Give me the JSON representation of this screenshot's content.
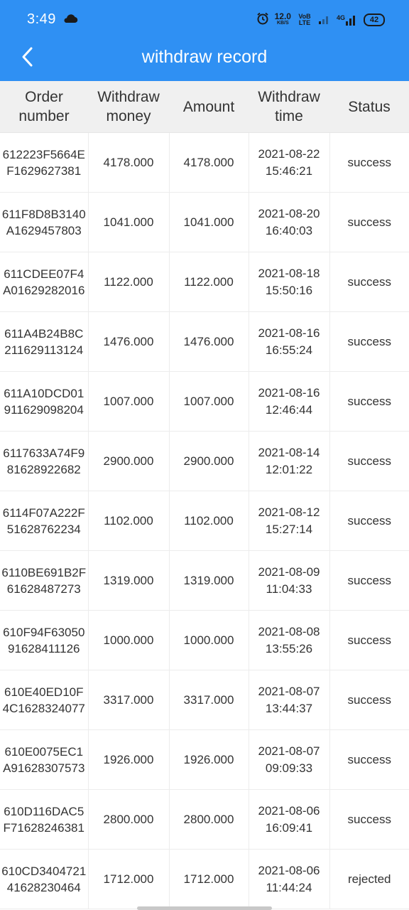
{
  "status_bar": {
    "time": "3:49",
    "net_speed": "12.0",
    "net_unit": "KB/S",
    "volte": "VoB LTE",
    "network": "4G",
    "battery": "42"
  },
  "header": {
    "title": "withdraw record"
  },
  "colors": {
    "header_bg": "#2f90f3",
    "table_header_bg": "#f0f0f0"
  },
  "columns": {
    "order": "Order number",
    "withdraw_money": "Withdraw money",
    "amount": "Amount",
    "withdraw_time": "Withdraw time",
    "status": "Status"
  },
  "records": [
    {
      "order": "612223F5664EF1629627381",
      "withdraw_money": "4178.000",
      "amount": "4178.000",
      "date": "2021-08-22",
      "time": "15:46:21",
      "status": "success"
    },
    {
      "order": "611F8D8B3140A1629457803",
      "withdraw_money": "1041.000",
      "amount": "1041.000",
      "date": "2021-08-20",
      "time": "16:40:03",
      "status": "success"
    },
    {
      "order": "611CDEE07F4A01629282016",
      "withdraw_money": "1122.000",
      "amount": "1122.000",
      "date": "2021-08-18",
      "time": "15:50:16",
      "status": "success"
    },
    {
      "order": "611A4B24B8C211629113124",
      "withdraw_money": "1476.000",
      "amount": "1476.000",
      "date": "2021-08-16",
      "time": "16:55:24",
      "status": "success"
    },
    {
      "order": "611A10DCD01911629098204",
      "withdraw_money": "1007.000",
      "amount": "1007.000",
      "date": "2021-08-16",
      "time": "12:46:44",
      "status": "success"
    },
    {
      "order": "6117633A74F981628922682",
      "withdraw_money": "2900.000",
      "amount": "2900.000",
      "date": "2021-08-14",
      "time": "12:01:22",
      "status": "success"
    },
    {
      "order": "6114F07A222F51628762234",
      "withdraw_money": "1102.000",
      "amount": "1102.000",
      "date": "2021-08-12",
      "time": "15:27:14",
      "status": "success"
    },
    {
      "order": "6110BE691B2F61628487273",
      "withdraw_money": "1319.000",
      "amount": "1319.000",
      "date": "2021-08-09",
      "time": "11:04:33",
      "status": "success"
    },
    {
      "order": "610F94F6305091628411126",
      "withdraw_money": "1000.000",
      "amount": "1000.000",
      "date": "2021-08-08",
      "time": "13:55:26",
      "status": "success"
    },
    {
      "order": "610E40ED10F4C1628324077",
      "withdraw_money": "3317.000",
      "amount": "3317.000",
      "date": "2021-08-07",
      "time": "13:44:37",
      "status": "success"
    },
    {
      "order": "610E0075EC1A91628307573",
      "withdraw_money": "1926.000",
      "amount": "1926.000",
      "date": "2021-08-07",
      "time": "09:09:33",
      "status": "success"
    },
    {
      "order": "610D116DAC5F71628246381",
      "withdraw_money": "2800.000",
      "amount": "2800.000",
      "date": "2021-08-06",
      "time": "16:09:41",
      "status": "success"
    },
    {
      "order": "610CD340472141628230464",
      "withdraw_money": "1712.000",
      "amount": "1712.000",
      "date": "2021-08-06",
      "time": "11:44:24",
      "status": "rejected"
    }
  ]
}
